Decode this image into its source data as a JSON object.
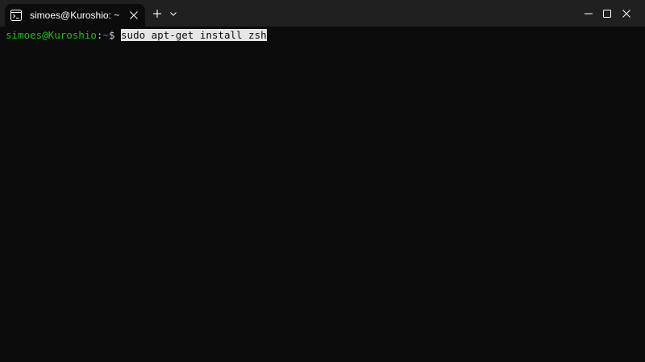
{
  "window": {
    "title": "simoes@Kuroshio: ~",
    "icons": {
      "tab": "terminal-icon",
      "close_tab": "close-icon",
      "new_tab": "plus-icon",
      "dropdown": "chevron-down-icon",
      "minimize": "minimize-icon",
      "maximize": "maximize-icon",
      "close_window": "close-icon"
    }
  },
  "terminal": {
    "prompt_user_host": "simoes@Kuroshio",
    "prompt_separator": ":",
    "prompt_path": "~",
    "prompt_symbol": "$",
    "command": "sudo apt-get install zsh"
  },
  "colors": {
    "background": "#0c0c0c",
    "titlebar": "#202020",
    "user_host": "#16c60c",
    "path": "#3b78ff",
    "selection": "#e6e6e6"
  }
}
